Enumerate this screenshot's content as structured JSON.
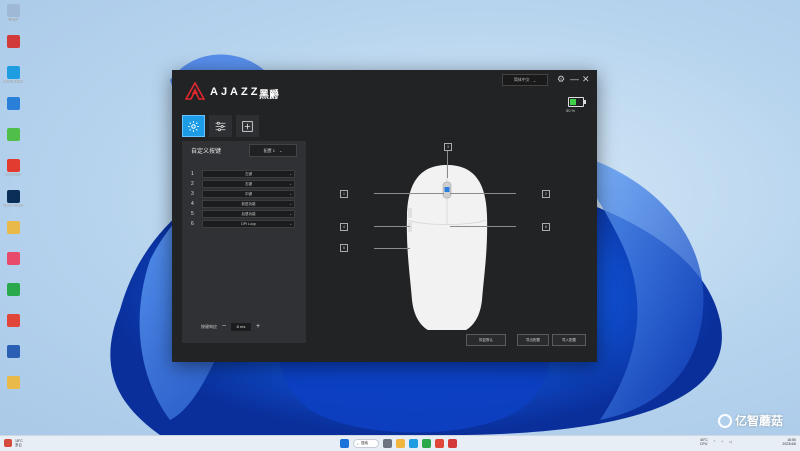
{
  "desktop": {
    "icons": [
      {
        "label": "回收站",
        "color": "#9fb8d6"
      },
      {
        "label": "",
        "color": "#d33b3b"
      },
      {
        "label": "Microsoft Edge",
        "color": "#1e9de0"
      },
      {
        "label": "",
        "color": "#2a7fd8"
      },
      {
        "label": "",
        "color": "#4fbf4a"
      },
      {
        "label": "WPS Office",
        "color": "#e23b2f"
      },
      {
        "label": "Adobe Photoshop",
        "color": "#0b2e59"
      },
      {
        "label": "",
        "color": "#e9b949"
      },
      {
        "label": "",
        "color": "#e84a6a"
      },
      {
        "label": "",
        "color": "#2aa84c"
      },
      {
        "label": "",
        "color": "#e0463a"
      },
      {
        "label": "",
        "color": "#2b5fb4"
      },
      {
        "label": "",
        "color": "#e9b949"
      }
    ]
  },
  "app": {
    "brand": "AJAZZ",
    "brand_cn": "黑爵",
    "language_select": "简体中文",
    "battery_percent": 50,
    "battery_text": "50 %",
    "tabs": [
      {
        "name": "settings",
        "active": true
      },
      {
        "name": "sliders",
        "active": false
      },
      {
        "name": "macro",
        "active": false
      }
    ],
    "panel": {
      "title": "自定义按键",
      "config_select": "配置 1",
      "buttons": [
        {
          "num": "1",
          "value": "左键"
        },
        {
          "num": "2",
          "value": "右键"
        },
        {
          "num": "3",
          "value": "中键"
        },
        {
          "num": "4",
          "value": "前进功能"
        },
        {
          "num": "5",
          "value": "后退功能"
        },
        {
          "num": "6",
          "value": "DPI Loop"
        }
      ],
      "debounce_label": "按键响应",
      "debounce_value": "8 ms",
      "minus": "−",
      "plus": "+"
    },
    "callouts": [
      "1",
      "2",
      "3",
      "4",
      "5",
      "6"
    ],
    "footer_buttons": [
      "恢复默认",
      "导出配置",
      "导入配置"
    ],
    "accent": "#1d9be6"
  },
  "taskbar": {
    "weather": "18°C",
    "weather_sub": "多云",
    "search": "搜索",
    "temp": "40°C",
    "temp_sub": "CPU",
    "time": "16:50",
    "date": "2023/4/6"
  },
  "watermark": "亿智蘑菇"
}
